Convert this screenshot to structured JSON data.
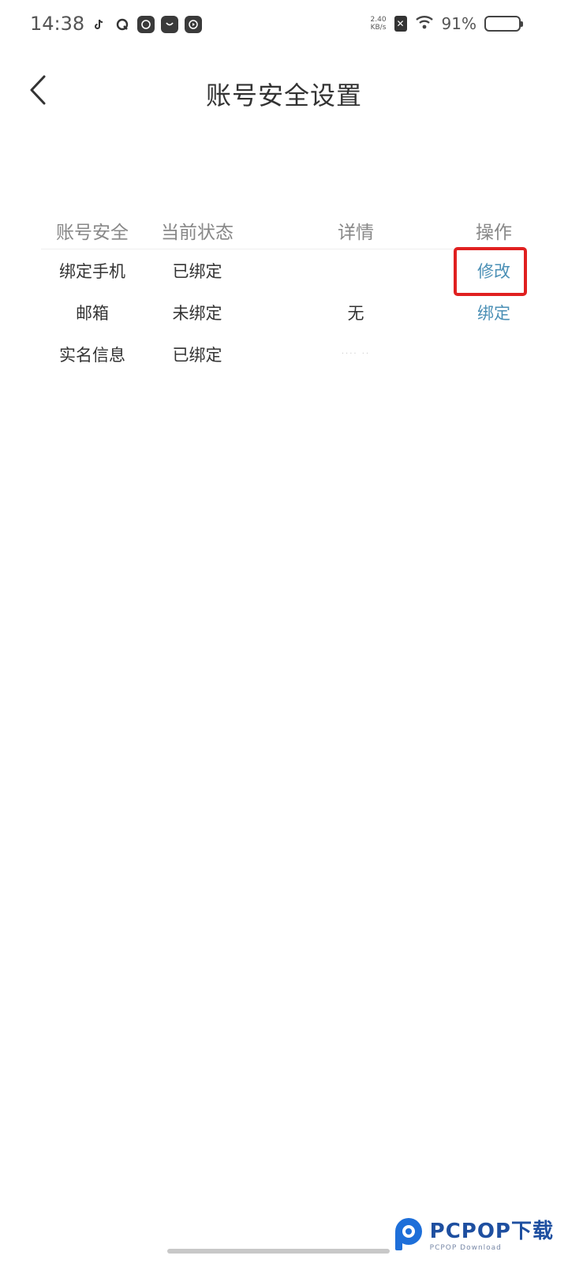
{
  "status_bar": {
    "time": "14:38",
    "app_icons": [
      "tiktok-icon",
      "quark-icon",
      "du-icon",
      "shop-icon",
      "player-icon"
    ],
    "net_speed_value": "2.40",
    "net_speed_unit": "KB/s",
    "sim_icon": "✕",
    "battery_percent": "91%"
  },
  "header": {
    "title": "账号安全设置"
  },
  "table": {
    "columns": [
      "账号安全",
      "当前状态",
      "详情",
      "操作"
    ],
    "rows": [
      {
        "item": "绑定手机",
        "status": "已绑定",
        "detail": "",
        "action": "修改"
      },
      {
        "item": "邮箱",
        "status": "未绑定",
        "detail": "无",
        "action": "绑定"
      },
      {
        "item": "实名信息",
        "status": "已绑定",
        "detail": "····  ··",
        "action": ""
      }
    ]
  },
  "watermark": {
    "main": "PCPOP下载",
    "sub": "PCPOP Download"
  },
  "colors": {
    "action": "#4a8fb5",
    "highlight": "#e02020",
    "brand": "#1e4fa0"
  }
}
